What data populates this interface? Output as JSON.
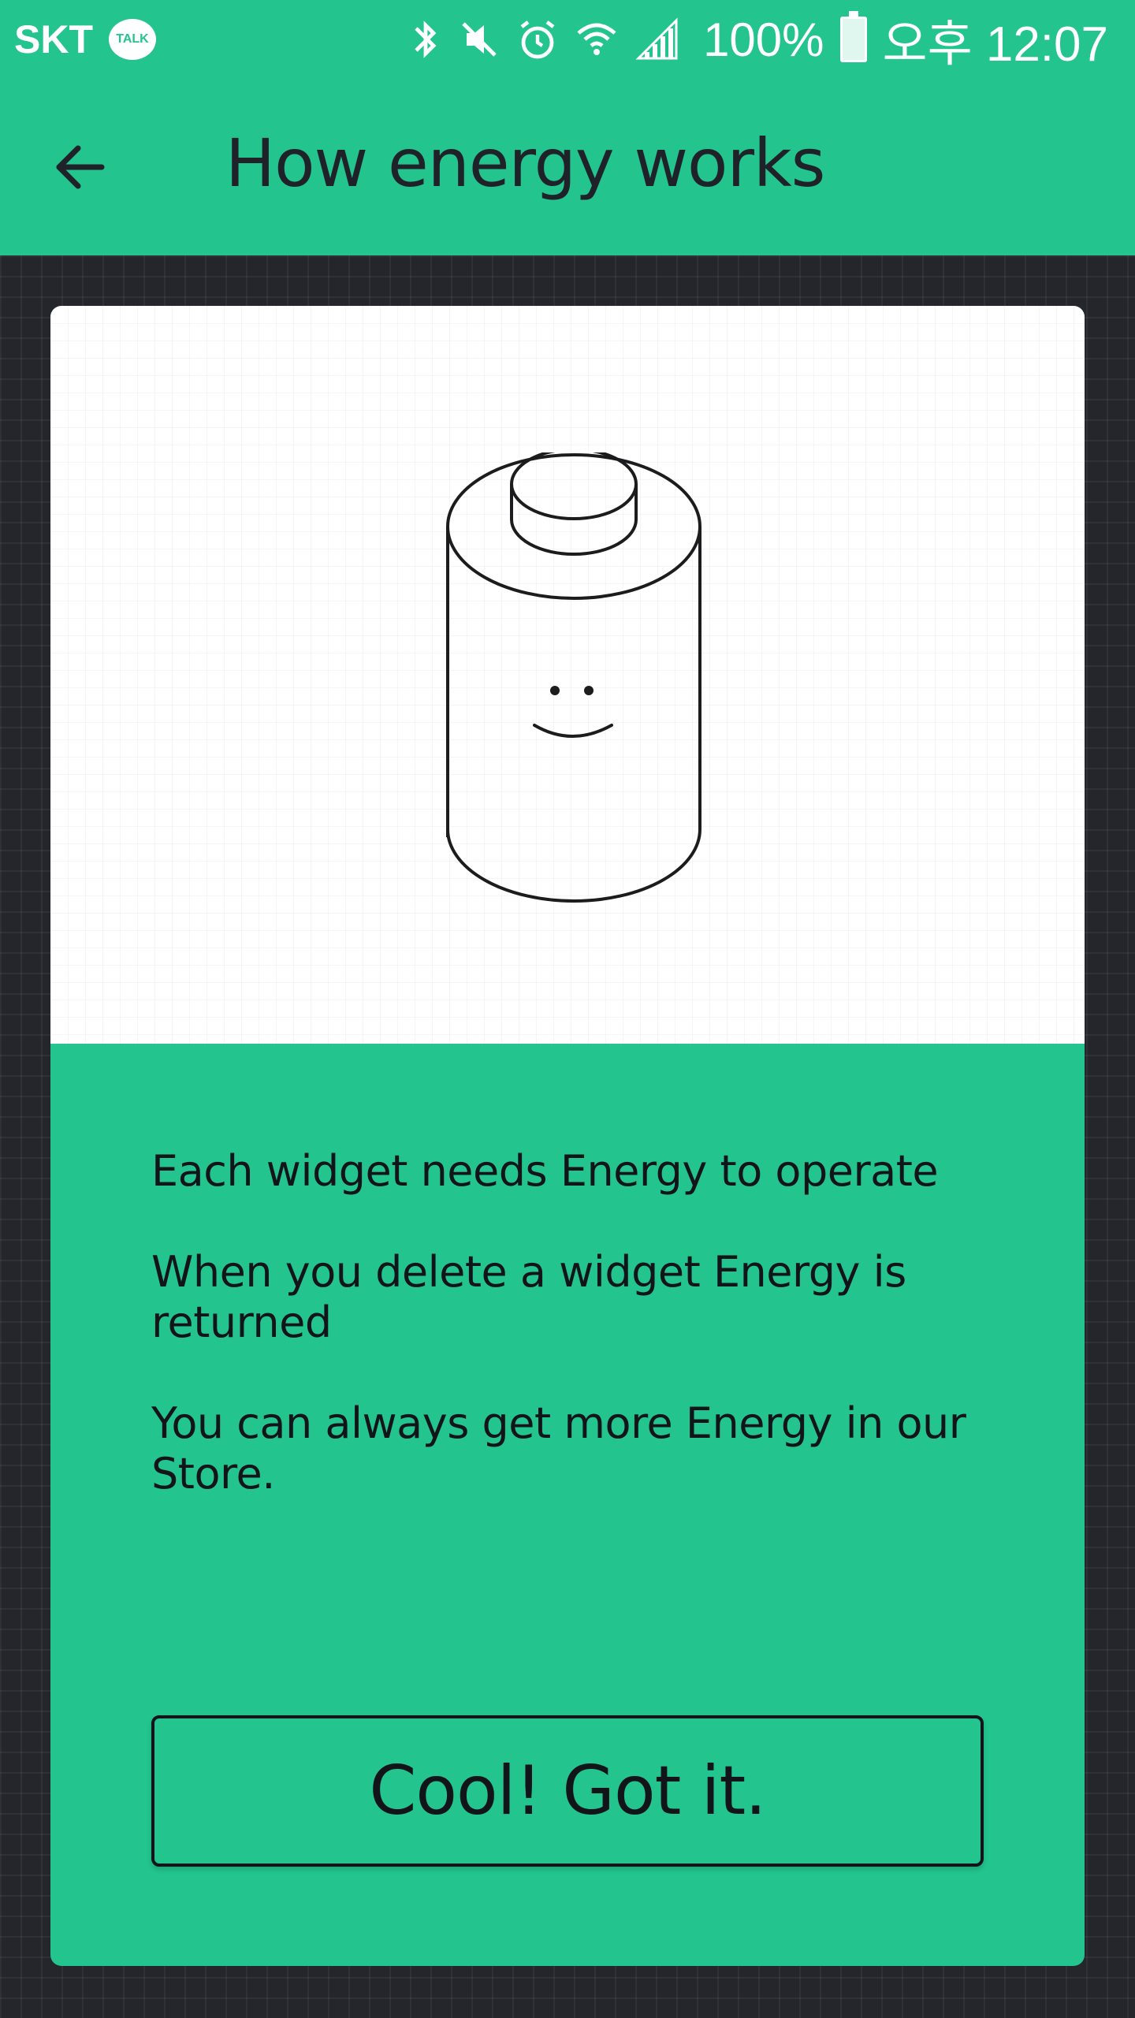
{
  "status_bar": {
    "carrier": "SKT",
    "talk_badge": "TALK",
    "battery_percent": "100%",
    "time": "오후 12:07",
    "icons": [
      "talk-icon",
      "bluetooth-icon",
      "mute-icon",
      "alarm-icon",
      "wifi-icon",
      "signal-icon",
      "battery-icon"
    ]
  },
  "header": {
    "back_icon": "arrow-left-icon",
    "title": "How energy works"
  },
  "illustration": {
    "icon": "battery-mascot-icon"
  },
  "info": {
    "lines": [
      "Each widget needs Energy to operate",
      "When you delete a widget Energy is returned",
      "You can always get more Energy in our Store."
    ]
  },
  "actions": {
    "confirm_label": "Cool! Got it."
  },
  "colors": {
    "accent": "#23c48e",
    "background": "#24262c",
    "text_dark": "#111418",
    "card_illustration_bg": "#ffffff"
  }
}
